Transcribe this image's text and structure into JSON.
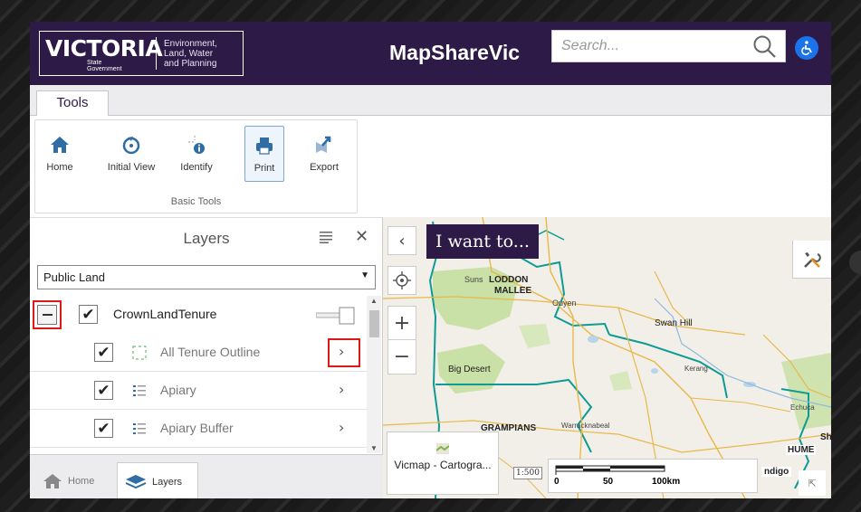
{
  "header": {
    "logo_text": "VICTORIA",
    "logo_sub_1": "State",
    "logo_sub_2": "Government",
    "dept_1": "Environment,",
    "dept_2": "Land, Water",
    "dept_3": "and Planning",
    "app_title": "MapShareVic",
    "search_placeholder": "Search...",
    "brand_color": "#2e1a47",
    "accessibility_color": "#1a73e8"
  },
  "ribbon": {
    "tab": "Tools",
    "tools": [
      {
        "label": "Home",
        "icon": "home-icon"
      },
      {
        "label": "Initial View",
        "icon": "initial-view-icon"
      },
      {
        "label": "Identify",
        "icon": "identify-icon"
      },
      {
        "label": "Print",
        "icon": "printer-icon",
        "active": true
      },
      {
        "label": "Export",
        "icon": "export-icon"
      }
    ],
    "group_label": "Basic Tools"
  },
  "layers_panel": {
    "title": "Layers",
    "select_value": "Public Land",
    "rows": [
      {
        "label": "CrownLandTenure",
        "checked": true
      },
      {
        "label": "All Tenure Outline",
        "checked": true
      },
      {
        "label": "Apiary",
        "checked": true
      },
      {
        "label": "Apiary Buffer",
        "checked": true
      }
    ],
    "bottom_tabs": [
      "Home",
      "Layers"
    ]
  },
  "map": {
    "i_want_to": "I want to...",
    "labels": [
      "Suns",
      "LODDON",
      "MALLEE",
      "Ouyen",
      "Swan Hill",
      "Big Desert",
      "Kerang",
      "GRAMPIANS",
      "Warracknabeal",
      "Echuca",
      "HUME",
      "ndigo",
      "Sh"
    ],
    "basemap_label": "Vicmap - Cartogra...",
    "scale_badge": "1:500",
    "scale_ticks": [
      "0",
      "50",
      "100km"
    ]
  }
}
